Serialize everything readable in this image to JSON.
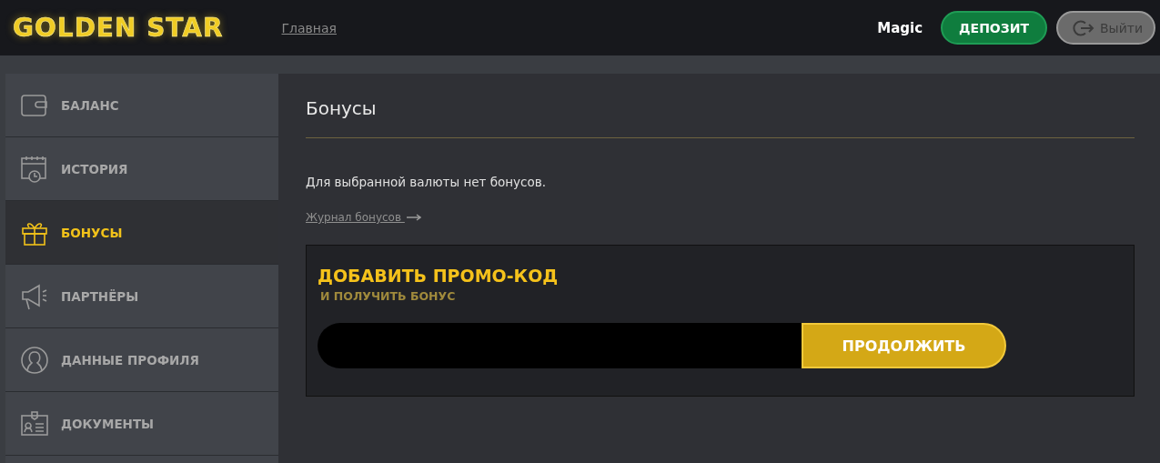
{
  "header": {
    "logo": "GOLDEN STAR",
    "nav_link": "Главная",
    "username": "Magic",
    "deposit_button": "ДЕПОЗИТ",
    "logout_button": "Выйти"
  },
  "sidebar": {
    "items": [
      {
        "label": "БАЛАНС",
        "selected": false
      },
      {
        "label": "ИСТОРИЯ",
        "selected": false
      },
      {
        "label": "БОНУСЫ",
        "selected": true
      },
      {
        "label": "ПАРТНЁРЫ",
        "selected": false
      },
      {
        "label": "ДАННЫЕ ПРОФИЛЯ",
        "selected": false
      },
      {
        "label": "ДОКУМЕНТЫ",
        "selected": false
      }
    ]
  },
  "content": {
    "title": "Бонусы",
    "message": "Для выбранной валюты нет бонусов.",
    "history_link": "Журнал бонусов ",
    "promo": {
      "title": "ДОБАВИТЬ ПРОМО-КОД",
      "subtitle": "И ПОЛУЧИТЬ БОНУС",
      "submit_button": "ПРОДОЛЖИТЬ"
    }
  }
}
